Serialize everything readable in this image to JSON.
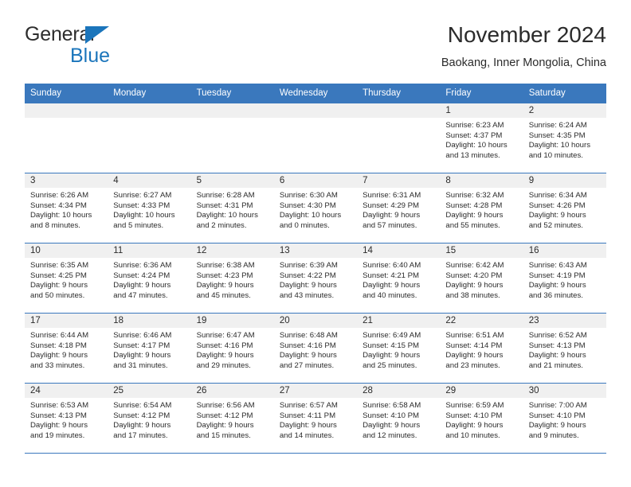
{
  "brand": {
    "name_dark": "General",
    "name_blue": "Blue",
    "triangle_icon": "triangle-logo-icon",
    "accent_color": "#1b75bb"
  },
  "header": {
    "title": "November 2024",
    "subtitle": "Baokang, Inner Mongolia, China"
  },
  "theme": {
    "header_blue": "#3a78bd",
    "day_band_gray": "#f0f0f0",
    "text": "#2b2b2b"
  },
  "calendar": {
    "weekday_headers": [
      "Sunday",
      "Monday",
      "Tuesday",
      "Wednesday",
      "Thursday",
      "Friday",
      "Saturday"
    ],
    "weeks": [
      [
        {
          "day": "",
          "empty": true
        },
        {
          "day": "",
          "empty": true
        },
        {
          "day": "",
          "empty": true
        },
        {
          "day": "",
          "empty": true
        },
        {
          "day": "",
          "empty": true
        },
        {
          "day": "1",
          "sunrise": "Sunrise: 6:23 AM",
          "sunset": "Sunset: 4:37 PM",
          "daylight1": "Daylight: 10 hours",
          "daylight2": "and 13 minutes."
        },
        {
          "day": "2",
          "sunrise": "Sunrise: 6:24 AM",
          "sunset": "Sunset: 4:35 PM",
          "daylight1": "Daylight: 10 hours",
          "daylight2": "and 10 minutes."
        }
      ],
      [
        {
          "day": "3",
          "sunrise": "Sunrise: 6:26 AM",
          "sunset": "Sunset: 4:34 PM",
          "daylight1": "Daylight: 10 hours",
          "daylight2": "and 8 minutes."
        },
        {
          "day": "4",
          "sunrise": "Sunrise: 6:27 AM",
          "sunset": "Sunset: 4:33 PM",
          "daylight1": "Daylight: 10 hours",
          "daylight2": "and 5 minutes."
        },
        {
          "day": "5",
          "sunrise": "Sunrise: 6:28 AM",
          "sunset": "Sunset: 4:31 PM",
          "daylight1": "Daylight: 10 hours",
          "daylight2": "and 2 minutes."
        },
        {
          "day": "6",
          "sunrise": "Sunrise: 6:30 AM",
          "sunset": "Sunset: 4:30 PM",
          "daylight1": "Daylight: 10 hours",
          "daylight2": "and 0 minutes."
        },
        {
          "day": "7",
          "sunrise": "Sunrise: 6:31 AM",
          "sunset": "Sunset: 4:29 PM",
          "daylight1": "Daylight: 9 hours",
          "daylight2": "and 57 minutes."
        },
        {
          "day": "8",
          "sunrise": "Sunrise: 6:32 AM",
          "sunset": "Sunset: 4:28 PM",
          "daylight1": "Daylight: 9 hours",
          "daylight2": "and 55 minutes."
        },
        {
          "day": "9",
          "sunrise": "Sunrise: 6:34 AM",
          "sunset": "Sunset: 4:26 PM",
          "daylight1": "Daylight: 9 hours",
          "daylight2": "and 52 minutes."
        }
      ],
      [
        {
          "day": "10",
          "sunrise": "Sunrise: 6:35 AM",
          "sunset": "Sunset: 4:25 PM",
          "daylight1": "Daylight: 9 hours",
          "daylight2": "and 50 minutes."
        },
        {
          "day": "11",
          "sunrise": "Sunrise: 6:36 AM",
          "sunset": "Sunset: 4:24 PM",
          "daylight1": "Daylight: 9 hours",
          "daylight2": "and 47 minutes."
        },
        {
          "day": "12",
          "sunrise": "Sunrise: 6:38 AM",
          "sunset": "Sunset: 4:23 PM",
          "daylight1": "Daylight: 9 hours",
          "daylight2": "and 45 minutes."
        },
        {
          "day": "13",
          "sunrise": "Sunrise: 6:39 AM",
          "sunset": "Sunset: 4:22 PM",
          "daylight1": "Daylight: 9 hours",
          "daylight2": "and 43 minutes."
        },
        {
          "day": "14",
          "sunrise": "Sunrise: 6:40 AM",
          "sunset": "Sunset: 4:21 PM",
          "daylight1": "Daylight: 9 hours",
          "daylight2": "and 40 minutes."
        },
        {
          "day": "15",
          "sunrise": "Sunrise: 6:42 AM",
          "sunset": "Sunset: 4:20 PM",
          "daylight1": "Daylight: 9 hours",
          "daylight2": "and 38 minutes."
        },
        {
          "day": "16",
          "sunrise": "Sunrise: 6:43 AM",
          "sunset": "Sunset: 4:19 PM",
          "daylight1": "Daylight: 9 hours",
          "daylight2": "and 36 minutes."
        }
      ],
      [
        {
          "day": "17",
          "sunrise": "Sunrise: 6:44 AM",
          "sunset": "Sunset: 4:18 PM",
          "daylight1": "Daylight: 9 hours",
          "daylight2": "and 33 minutes."
        },
        {
          "day": "18",
          "sunrise": "Sunrise: 6:46 AM",
          "sunset": "Sunset: 4:17 PM",
          "daylight1": "Daylight: 9 hours",
          "daylight2": "and 31 minutes."
        },
        {
          "day": "19",
          "sunrise": "Sunrise: 6:47 AM",
          "sunset": "Sunset: 4:16 PM",
          "daylight1": "Daylight: 9 hours",
          "daylight2": "and 29 minutes."
        },
        {
          "day": "20",
          "sunrise": "Sunrise: 6:48 AM",
          "sunset": "Sunset: 4:16 PM",
          "daylight1": "Daylight: 9 hours",
          "daylight2": "and 27 minutes."
        },
        {
          "day": "21",
          "sunrise": "Sunrise: 6:49 AM",
          "sunset": "Sunset: 4:15 PM",
          "daylight1": "Daylight: 9 hours",
          "daylight2": "and 25 minutes."
        },
        {
          "day": "22",
          "sunrise": "Sunrise: 6:51 AM",
          "sunset": "Sunset: 4:14 PM",
          "daylight1": "Daylight: 9 hours",
          "daylight2": "and 23 minutes."
        },
        {
          "day": "23",
          "sunrise": "Sunrise: 6:52 AM",
          "sunset": "Sunset: 4:13 PM",
          "daylight1": "Daylight: 9 hours",
          "daylight2": "and 21 minutes."
        }
      ],
      [
        {
          "day": "24",
          "sunrise": "Sunrise: 6:53 AM",
          "sunset": "Sunset: 4:13 PM",
          "daylight1": "Daylight: 9 hours",
          "daylight2": "and 19 minutes."
        },
        {
          "day": "25",
          "sunrise": "Sunrise: 6:54 AM",
          "sunset": "Sunset: 4:12 PM",
          "daylight1": "Daylight: 9 hours",
          "daylight2": "and 17 minutes."
        },
        {
          "day": "26",
          "sunrise": "Sunrise: 6:56 AM",
          "sunset": "Sunset: 4:12 PM",
          "daylight1": "Daylight: 9 hours",
          "daylight2": "and 15 minutes."
        },
        {
          "day": "27",
          "sunrise": "Sunrise: 6:57 AM",
          "sunset": "Sunset: 4:11 PM",
          "daylight1": "Daylight: 9 hours",
          "daylight2": "and 14 minutes."
        },
        {
          "day": "28",
          "sunrise": "Sunrise: 6:58 AM",
          "sunset": "Sunset: 4:10 PM",
          "daylight1": "Daylight: 9 hours",
          "daylight2": "and 12 minutes."
        },
        {
          "day": "29",
          "sunrise": "Sunrise: 6:59 AM",
          "sunset": "Sunset: 4:10 PM",
          "daylight1": "Daylight: 9 hours",
          "daylight2": "and 10 minutes."
        },
        {
          "day": "30",
          "sunrise": "Sunrise: 7:00 AM",
          "sunset": "Sunset: 4:10 PM",
          "daylight1": "Daylight: 9 hours",
          "daylight2": "and 9 minutes."
        }
      ]
    ]
  }
}
